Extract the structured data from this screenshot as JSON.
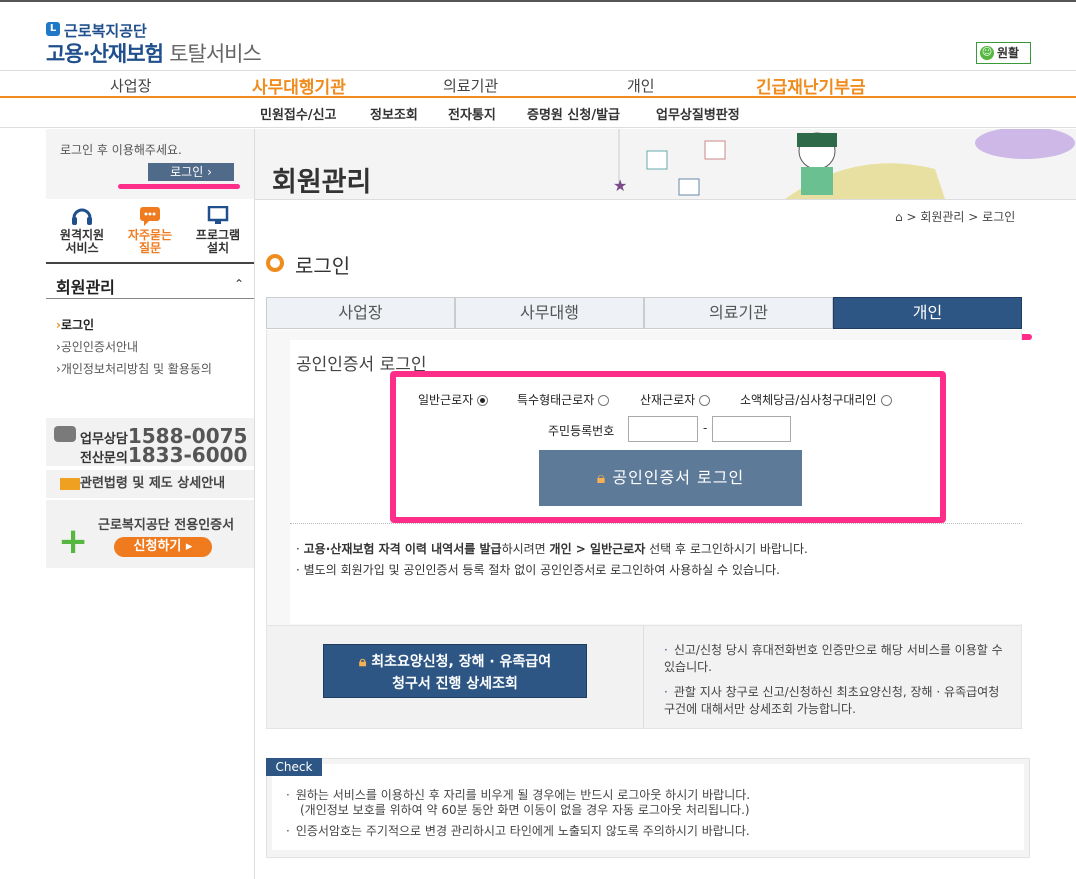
{
  "header": {
    "org_small": "근로복지공단",
    "title_main": "고용·산재보험",
    "title_sub": "토탈서비스",
    "smile_label": "원활"
  },
  "gnb": [
    "사업장",
    "사무대행기관",
    "의료기관",
    "개인",
    "긴급재난기부금"
  ],
  "subnav": [
    "민원접수/신고",
    "정보조회",
    "전자통지",
    "증명원 신청/발급",
    "업무상질병판정"
  ],
  "sidebar": {
    "login_message": "로그인 후 이용해주세요.",
    "login_button": "로그인",
    "quick": [
      {
        "label1": "원격지원",
        "label2": "서비스"
      },
      {
        "label1": "자주묻는",
        "label2": "질문"
      },
      {
        "label1": "프로그램",
        "label2": "설치"
      }
    ],
    "menu_title": "회원관리",
    "menu_items": [
      "로그인",
      "공인인증서안내",
      "개인정보처리방침 및 활용동의"
    ],
    "cs_label1": "업무상담",
    "cs_phone1": "1588-0075",
    "cs_label2": "전산문의",
    "cs_phone2": "1833-6000",
    "law_link": "관련법령 및 제도 상세안내",
    "cert_title": "근로복지공단 전용인증서",
    "cert_button": "신청하기"
  },
  "banner": {
    "title": "회원관리",
    "breadcrumb": [
      "회원관리",
      "로그인"
    ]
  },
  "page": {
    "title": "로그인",
    "tabs": [
      "사업장",
      "사무대행",
      "의료기관",
      "개인"
    ],
    "active_tab": "개인",
    "cert_login_title": "공인인증서 로그인",
    "radios": [
      "일반근로자",
      "특수형태근로자",
      "산재근로자",
      "소액체당금/심사청구대리인"
    ],
    "rrn_label": "주민등록번호",
    "rrn_dash": "-",
    "login_button": "공인인증서 로그인",
    "note1_a": "고용·산재보험 자격 이력 내역서를 발급",
    "note1_b": "하시려면 ",
    "note1_c": "개인 > 일반근로자",
    "note1_d": " 선택 후 로그인하시기 바랍니다.",
    "note2": "별도의 회원가입 및 공인인증서 등록 절차 없이 공인인증서로 로그인하여 사용하실 수 있습니다.",
    "detail_button_line1": "최초요양신청, 장해 · 유족급여",
    "detail_button_line2": "청구서 진행 상세조회",
    "right_note1": "신고/신청 당시 휴대전화번호 인증만으로 해당 서비스를 이용할 수 있습니다.",
    "right_note2": "관할 지사 창구로 신고/신청하신 최초요양신청, 장해 · 유족급여청구건에 대해서만 상세조회 가능합니다."
  },
  "check": {
    "tag": "Check",
    "line1": "원하는 서비스를 이용하신 후 자리를 비우게 될 경우에는 반드시 로그아웃 하시기 바랍니다.",
    "line1b": "(개인정보 보호를 위하여 약 60분 동안 화면 이동이 없을 경우 자동 로그아웃 처리됩니다.)",
    "line2": "인증서암호는 주기적으로 변경 관리하시고 타인에게 노출되지 않도록 주의하시기 바랍니다."
  },
  "colors": {
    "accent_orange": "#f08c1e",
    "navy": "#2d5685",
    "highlight_pink": "#ff2d8a"
  }
}
